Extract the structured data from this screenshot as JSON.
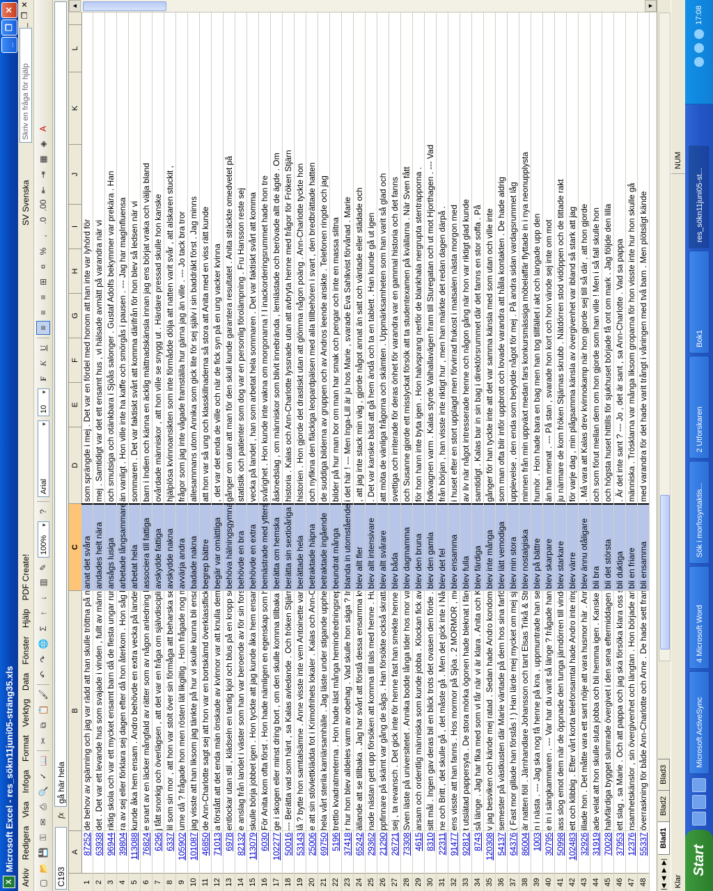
{
  "window": {
    "title": "Microsoft Excel - res_sökn11juni05-sträng35.xls",
    "help_box": "Skriv en fråga för hjälp"
  },
  "menu": [
    "Arkiv",
    "Redigera",
    "Visa",
    "Infoga",
    "Format",
    "Verktyg",
    "Data",
    "Fönster",
    "Hjälp",
    "PDF Create!"
  ],
  "language": "SV Svenska",
  "toolbar": {
    "zoom": "100%",
    "font": "Arial",
    "size": "10"
  },
  "formula": {
    "namebox": "C193",
    "fx": "fx",
    "content": "gå här hela"
  },
  "columns": [
    "A",
    "B",
    "C",
    "D",
    "E",
    "F",
    "G",
    "H",
    "I",
    "J",
    "K",
    "L"
  ],
  "rows": [
    {
      "n": "1",
      "a": "87252",
      "b": "de behov av spänning och jag var rädd att han skulle tröttna på mej om han",
      "c": "anat det svåra",
      "d": "som sprängde i mej . Det var en fördel med honom att han inte var lyhörd för"
    },
    {
      "n": "2",
      "a": "63938",
      "b": "det . Det var ett levande hus som svajade i vinden , fullt av människor som",
      "c": "andades helt nära",
      "d": "mej . Samtidigt var det ett ensamt hus , vi hälsade avmätt på varandra när vi"
    },
    {
      "n": "3",
      "a": "96944",
      "b": "riktig skola och var ett mycket ensamt barn då de flesta ungar runt omkring",
      "c": "ansågs lusiga",
      "d": "och smutsiga och otänkbara i Sjöås salonger . Gustaf Adolfs bekymmer var prekära . Han"
    },
    {
      "n": "4",
      "a": "39804",
      "b": "ra av sej eller förklara sej dagen efter då hon återkom . Hon såg blek ut och",
      "c": "arbetade långsammare",
      "d": "än vanligt . Hon ville inte ha kaffe och smörgås i pausen . --- Jag har magInfluensa"
    },
    {
      "n": "5",
      "a": "113088",
      "b": "kunde åka hem ensam . Andro behövde en extra vecka på landet , han som",
      "c": "arbetat hela",
      "d": "sommaren . Det var faktiskt svårt att komma därifrån för hon blev så ledsen när vi"
    },
    {
      "n": "6",
      "a": "76824",
      "b": "e snart av en läcker mångfald av rätter som av någon anledning kom mej att",
      "c": "associera till fattiga",
      "d": "barn i Indien och känna en äcklig mättnadskänsla innan jag ens börjat vraka och välja bland"
    },
    {
      "n": "7",
      "a": "6296",
      "b": "j fått snorkig och överlägsen , att det var en fråga om självdisciplin , att hon",
      "c": "avskydde fattiga",
      "d": "ovårdade människor , att hon ville se snygg ut . Härdare pressad skulle hon kanske"
    },
    {
      "n": "8",
      "a": "6337",
      "b": "lil som sin mor , att hon var stolt över sin förmåga att beharska sej , att hon",
      "c": "avskydde nakna",
      "d": "hjälplösa kvinnoansikten som inte förmådde dölja att natten varit svår , att alskaren stuckit ,"
    },
    {
      "n": "9",
      "a": "105902",
      "b": "ume då ? frågade hon men rösten lät likgiltig . Hon frågade nog mest för att",
      "c": "avvärja andra",
      "d": "frågor som jag inte vågade framställa hur gärna jag än ville . --- Jo tack bra tror"
    },
    {
      "n": "10",
      "a": "101087",
      "b": "jag visste att han liksom jag tänkte på hur vi skulle kunna bli ensamma . Vi",
      "c": "badade nakna",
      "d": "allesammans utom Annika som gick lite för sej själv i sin baddräkt först . Jag minns"
    },
    {
      "n": "11",
      "a": "46850",
      "b": "de Ann-Charlotte sagt sej att hon var en bortskämd överklassflicka som inte",
      "c": "begrep bättre",
      "d": "att hon var så ung och klasskillnaderna så stora att Anita med en viss rätt kunde"
    },
    {
      "n": "12",
      "a": "71013",
      "b": "a förstått att det enda män önskade av kvinnor var att knulla dem , att deras",
      "c": "begär var omättliga",
      "d": ", det var det enda de ville och när de fick syn på en ung vacker kvinna"
    },
    {
      "n": "13",
      "a": "6978",
      "b": "entlockar utan stil , klädseln en tantig kjol och blus på en kropp som skulle",
      "c": "behöva hälningsgymnastik många",
      "d": "gånger om utan att man för den skull kunde garantera resultatet . Anita sträckte omedvetet på"
    },
    {
      "n": "14",
      "a": "82132",
      "b": "e anslag från landet i väster som han var beroende av för sin forskning . Han",
      "c": "behövde en bra",
      "d": "statistik och patienter som dog var en personlig förolämpning . Fru Hansson reste sej"
    },
    {
      "n": "15",
      "a": "113079",
      "b": "skulle börja jobbet igen . Hon tyckte att jag kunde åka hem ensam . Andro",
      "c": "behövde en extra",
      "d": "vecka på landet , han som arbetat hela sommaren . Det var faktiskt svårt att komma"
    },
    {
      "n": "16",
      "a": "6030",
      "b": "För Anita kom ofta först . Hon hade nämligen en egenskap som han bara",
      "c": "bemästrade med yttersta",
      "d": "svårighet . Hon kunde inte vakna om morgonarna ! I inackorderingsrummet hade hon tre"
    },
    {
      "n": "17",
      "a": "102277",
      "b": "ge i skogen eller minst dring bort , om den skulle komma tillbaka igen . Hon kunde",
      "c": "berätta om hemska",
      "d": "åsknedslag , om människor som blivit innebrända , lemlästade och berövade allt de ägde . Om"
    },
    {
      "n": "18",
      "a": "50016",
      "b": "--- Berätta vad som hänt , sa Kalas avledande . Och fröken Stjärna började",
      "c": "berätta sin sextioåriga",
      "d": "historia . Kalas och Ann-Charlotte lyssnade utan att avbryta henne med frågor för Fröken Stjärn"
    },
    {
      "n": "19",
      "a": "53143",
      "b": "lå ? bytte hon samtalsämne . Anne visste inte vem Antoinette var och Kalas",
      "c": "berättade hela",
      "d": "historien . Hon gjorde det drastiskt utan att glömma någon poäng . Ann-Charlotte tyckte hon"
    },
    {
      "n": "20",
      "a": "25006",
      "b": "e att sin stövlettklädda fot i Krimofrihets lokaler . Kalas och Ann-Charlotte",
      "c": "betraktade häpna",
      "d": "och nyfikna den fläckiga leopardpälsen med alla tillbehören i svart , den bredbrättade hatten"
    },
    {
      "n": "21",
      "a": "69750",
      "b": "hela vårt sterila karriärsamhälle . Jag läste under stigande upphetsning och",
      "c": "betraktade ingående",
      "d": "de suddiga bilderna av gruppen och av Andros leende ansikte . Telefonen ringde och jag"
    },
    {
      "n": "22",
      "a": "5196",
      "b": "trettio kvadratmeterna . Hon hade läst många hemindredningsreportage och",
      "c": "beundrat många",
      "d": "bilder på hur man bor om man har smak och pengar och inte en massa slitna"
    },
    {
      "n": "23",
      "a": "37418",
      "b": "r hur hon blev alldeles varm av obehag . Vad skulle hon säga ? Inte ville hon",
      "c": "blanda in utomstående",
      "d": "i det här ! --- Men Inga-Lill är ju hos Marie , svarade Eva Sahlkvist förvånad . Marie"
    },
    {
      "n": "24",
      "a": "65242",
      "b": "ällande att se tillbaka . Jag har svårt att förstå dessa ensamma kvällar som",
      "c": "blev allt fler",
      "d": ", att jag inte stack min väg , gjorde något annat än satt och väntade eller städade och"
    },
    {
      "n": "25",
      "a": "29362",
      "b": "nade nästan gett upp försöken att komma till tals med henne . Huvudvärken",
      "c": "blev allt intensivare",
      "d": ". Det var kanske bäst att gå hem ändå och ta en tablett . Han kunde gå ut igen"
    },
    {
      "n": "26",
      "a": "21290",
      "b": "ppfinnare på skämt var gång de sågs . Han försökte också skratta men det",
      "c": "blev allt svårare",
      "d": "att möta de vänliga frågorna och skämten . Uppmärksamheten som han varit så glad och"
    },
    {
      "n": "27",
      "a": "26721",
      "b": "sej , ta revansch . Det gick inte för henne fast han smekte henne länge . De",
      "c": "blev båda",
      "d": "svettiga och irriterade för deras önhet för varandra var en gammal historia och det fanns"
    },
    {
      "n": "28",
      "a": "73308",
      "b": "Sven läste på universitetet . Annika bodde långa tider hos mor vars granfru",
      "c": "blev dagmamma",
      "d": "och Susanne gjorde ett misslyckat försök att ta studentexamen på kvällarna . När Sven fått"
    },
    {
      "n": "29",
      "a": "4615",
      "b": "arsam och ordentlig människa som kunde jobba . Klockan fick avgöra . Det",
      "c": "blev den bruna",
      "d": "för hon hann inte byta igen . Hon halvsprang nerför de blankhala nergrupta stentrapporna ."
    },
    {
      "n": "30",
      "a": "8310",
      "b": "sitt mål . Ingen gav deras bil en blick trots det ovasen den förde . Långsamt",
      "c": "blev den gamla",
      "d": "folkvagnen varm . Kalas styrde Valhallavägen fram till Sturegatan och ut mot Hjorthagen . --- Vad"
    },
    {
      "n": "31",
      "a": "22311",
      "b": "ne och Britt , det skulle gå , det måste gå . Men det gick inte i Någonstans",
      "c": "blev det fel",
      "d": "från början , han visste inte riktigt hur , men han märkte det redan dagen därpå ."
    },
    {
      "n": "32",
      "a": "91477",
      "b": "ens visste att han fanns . Hos mormor på Sjöa . 2 MORMOR , mor och jag",
      "c": "blev ensamma",
      "d": "i huset efter en stort upplagd men förvirrad frukost i matsalen nästa morgon med"
    },
    {
      "n": "33",
      "a": "92812",
      "b": "t utslätad pappersyta . De stora mörka ögonen hade bleknat i färgen men",
      "c": "blev fulla",
      "d": "av liv när något intresserade henne och någon gång när hon var riktigt glad kunde"
    },
    {
      "n": "34",
      "a": "8743",
      "b": "så länge . Jag har fika med som vi får när vi är klara . Anita och Kalas",
      "c": "blev färdiga",
      "d": "samtidigt . Kalas bar in sin bag i direktörsrummet där det fanns en stor soffa . På"
    },
    {
      "n": "35",
      "a": "120308",
      "b": "v jag besviken och kände mej ratad . Sedan hade Andro kondom , men det",
      "c": "blev inte många",
      "d": "gånger för han tyckte inte att det var samma känsla med som utan och ville inte"
    },
    {
      "n": "36",
      "a": "54137",
      "b": "semester på västkusten där Marie väntade på dem hos sina farföräldrar . De",
      "c": "blev lätt vemodiga",
      "d": "som man ofta blir inför uppbrott och lovade varandra att hålla kontakten . De hade aldrig"
    },
    {
      "n": "37",
      "a": "64376",
      "b": "( Fast mor gillade han förstås ! ) Han lärde mej mycket om mej själv . Han",
      "c": "blev min stora",
      "d": "upplevelse , den enda som betydde något för mej . På andra sidan vardagsrummet låg"
    },
    {
      "n": "38",
      "a": "86004",
      "b": "är natten föll . Järnhandlare Johansson och tant Elsas Trikå & Strumpbutik",
      "c": "blev nostalgiska",
      "d": "minnen från min uppväxt medan fars konkursmässiga möbelaffär flyttade in i nya neonupplysta"
    },
    {
      "n": "39",
      "a": "1003",
      "b": "n i nästa . --- Jag ska nog få henne på kna , uppmuntrade han sej själv och",
      "c": "blev på bättre",
      "d": "humör . Hon hade bara en bag men han tog tillfället i akt och langade upp den"
    },
    {
      "n": "40",
      "a": "30795",
      "b": "e in i sängkammaren . --- Var har du varit så länge ? frågade han och rösten",
      "c": "blev skarpare",
      "d": "än han menat . --- På stan , svarade hon kort och hon vände sej inte om mot"
    },
    {
      "n": "41",
      "a": "50998",
      "b": "ass slog emot dem när de öppnade den tunga järndörren till vinden och den",
      "c": "blev starkare",
      "d": "ju närmare de kom fröken Stjärnas skrubb . Nätdörren stod vidöppen och de tittade rakt"
    },
    {
      "n": "42",
      "a": "102483",
      "b": "ett och klibbig . Efter vårt korta telefonsamtal hade Andro inte ringt . Min oro",
      "c": "blev värre",
      "d": "för varje dag , min plågsamma känsla av övergivenhet var ibland så stark att jag"
    },
    {
      "n": "43",
      "a": "32926",
      "b": "illade hon . Det måtte vara ett sant nöje att vara husmor här . Ann-Charlotte",
      "c": "blev ännu otåligare",
      "d": ". Må vara att Kalas drev kvinnokamp när hon gjorde sej till så där , att hon gjorde"
    },
    {
      "n": "44",
      "a": "31919",
      "b": "ade velat att hon skulle sluta jobba och bli hemma igen . Kanske skulle allt",
      "c": "bli bra",
      "d": "och som förut mellan dem om hon gjorde som han ville ! Men i så fall skulle hon"
    },
    {
      "n": "45",
      "a": "70028",
      "b": "halvfärdiga bygget slumrade övergivet i den sena eftermiddagen . Det skulle",
      "c": "bli det största",
      "d": "och högsta huset hittills för sjukhuset började få ont om mark . Jag följde den lilla"
    },
    {
      "n": "46",
      "a": "37953",
      "b": "ett slag , sa Marie . Och att pappa och jag ska försöka klara oss själva och",
      "c": "bli duktiga",
      "d": ". Är det inte sant ? --- Jo , det är sant , sa Ann-Charlotte . Vad sa pappa"
    },
    {
      "n": "47",
      "a": "12376",
      "b": "nsamhetskänslor , sin övergivenhet och längtan . Hon började arbeta på att",
      "c": "bli en friare",
      "d": "människa . Trösklarna var många liksom groparna för hon visste inte hur hon skulle gå"
    },
    {
      "n": "48",
      "a": "55337",
      "b": "överraskning för både Ann-Charlotte och Arne . De hade sett fram emot att",
      "c": "bli ensamma",
      "d": "med varandra för det hade varit trångt i våningen med två barn . Men plötsligt kände"
    }
  ],
  "sheets": [
    "Blad1",
    "Blad2",
    "Blad3"
  ],
  "status": {
    "left": "Klar",
    "num": "NUM"
  },
  "taskbar": {
    "start": "Start",
    "items": [
      "Microsoft ActiveSync",
      "4 Microsoft Word",
      "Sök i morfosyntaktis...",
      "2 Utforskaren",
      "Bok1",
      "res_sökn11juni05-st..."
    ],
    "clock": "17:08"
  }
}
